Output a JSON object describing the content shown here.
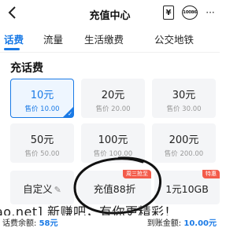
{
  "header": {
    "back_icon": "chevron-left-icon",
    "title": "充值中心",
    "yen_label": "¥",
    "service_label": "10086",
    "more_label": "···"
  },
  "tabs": [
    {
      "label": "话费",
      "active": true
    },
    {
      "label": "流量",
      "active": false
    },
    {
      "label": "生活缴费",
      "active": false
    },
    {
      "label": "公交地铁",
      "active": false
    }
  ],
  "section_title": "充话费",
  "recharge_options": [
    {
      "amount": "10元",
      "price": "售价 10.00",
      "selected": true
    },
    {
      "amount": "20元",
      "price": "售价 20.00",
      "selected": false
    },
    {
      "amount": "30元",
      "price": "售价 30.00",
      "selected": false
    },
    {
      "amount": "50元",
      "price": "售价 50.00",
      "selected": false
    },
    {
      "amount": "100元",
      "price": "售价 100.00",
      "selected": false
    },
    {
      "amount": "200元",
      "price": "售价 200.00",
      "selected": false
    }
  ],
  "extra_options": {
    "custom": {
      "label": "自定义"
    },
    "discount": {
      "label": "充值88折",
      "badge": "周三抢至"
    },
    "data_pack": {
      "label": "1元10GB",
      "badge": "特惠"
    }
  },
  "watermark": "ao.net] 新赚吧，有你更精彩！",
  "footer": {
    "balance_label": "话费余额:",
    "balance_value": "58元",
    "arrival_label": "到账金额:",
    "arrival_value": "10.00元"
  },
  "colors": {
    "accent": "#1a7ae6",
    "badge": "#f35b4a"
  }
}
